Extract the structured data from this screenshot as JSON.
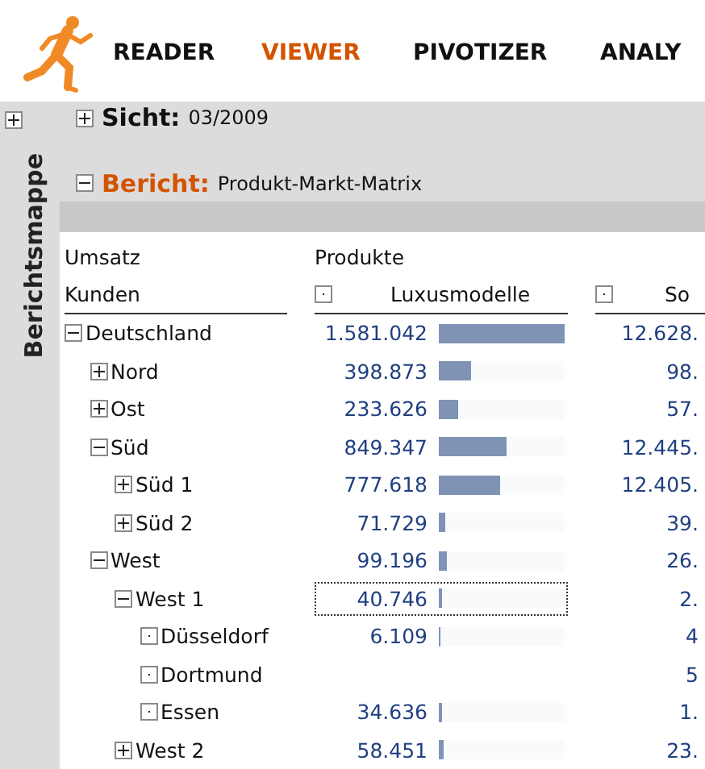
{
  "nav": [
    {
      "label": "READER",
      "selected": false
    },
    {
      "label": "VIEWER",
      "selected": true
    },
    {
      "label": "PIVOTIZER",
      "selected": false
    },
    {
      "label": "ANALY",
      "selected": false
    }
  ],
  "sidebar": {
    "title": "Berichtsmappe",
    "expanded": false
  },
  "view": {
    "label": "Sicht:",
    "value": "03/2009",
    "expanded": false
  },
  "report": {
    "label": "Bericht:",
    "value": "Produkt-Markt-Matrix",
    "expanded": true
  },
  "table": {
    "measure": "Umsatz",
    "column_dimension": "Produkte",
    "row_dimension": "Kunden",
    "columns": [
      {
        "label": "Luxusmodelle"
      },
      {
        "label": "So"
      }
    ],
    "rows": [
      {
        "label": "Deutschland",
        "kind": "node",
        "expanded": true,
        "focused": false,
        "luxus": {
          "value": "1.581.042",
          "level": 1
        },
        "column_3": "12.628.",
        "children": [
          {
            "label": "Nord",
            "kind": "node",
            "expanded": false,
            "focused": false,
            "luxus": {
              "value": "398.873",
              "level": 0.252
            },
            "column_3": "98."
          },
          {
            "label": "Ost",
            "kind": "node",
            "expanded": false,
            "focused": false,
            "luxus": {
              "value": "233.626",
              "level": 0.148
            },
            "column_3": "57."
          },
          {
            "label": "Süd",
            "kind": "node",
            "expanded": true,
            "focused": false,
            "luxus": {
              "value": "849.347",
              "level": 0.537
            },
            "column_3": "12.445.",
            "children": [
              {
                "label": "Süd 1",
                "kind": "node",
                "expanded": false,
                "focused": false,
                "luxus": {
                  "value": "777.618",
                  "level": 0.492
                },
                "column_3": "12.405."
              },
              {
                "label": "Süd 2",
                "kind": "node",
                "expanded": false,
                "focused": false,
                "luxus": {
                  "value": "71.729",
                  "level": 0.045
                },
                "column_3": "39."
              }
            ]
          },
          {
            "label": "West",
            "kind": "node",
            "expanded": true,
            "focused": false,
            "luxus": {
              "value": "99.196",
              "level": 0.063
            },
            "column_3": "26.",
            "children": [
              {
                "label": "West 1",
                "kind": "node",
                "expanded": true,
                "focused": true,
                "luxus": {
                  "value": "40.746",
                  "level": 0.026
                },
                "column_3": "2.",
                "children": [
                  {
                    "label": "Düsseldorf",
                    "kind": "leaf",
                    "focused": false,
                    "luxus": {
                      "value": "6.109",
                      "level": 0.004
                    },
                    "column_3": "4"
                  },
                  {
                    "label": "Dortmund",
                    "kind": "leaf",
                    "focused": false,
                    "column_3": "5"
                  },
                  {
                    "label": "Essen",
                    "kind": "leaf",
                    "focused": false,
                    "luxus": {
                      "value": "34.636",
                      "level": 0.022
                    },
                    "column_3": "1."
                  }
                ]
              },
              {
                "label": "West 2",
                "kind": "node",
                "expanded": false,
                "focused": false,
                "luxus": {
                  "value": "58.451",
                  "level": 0.037
                },
                "column_3": "23."
              }
            ]
          }
        ]
      }
    ]
  }
}
